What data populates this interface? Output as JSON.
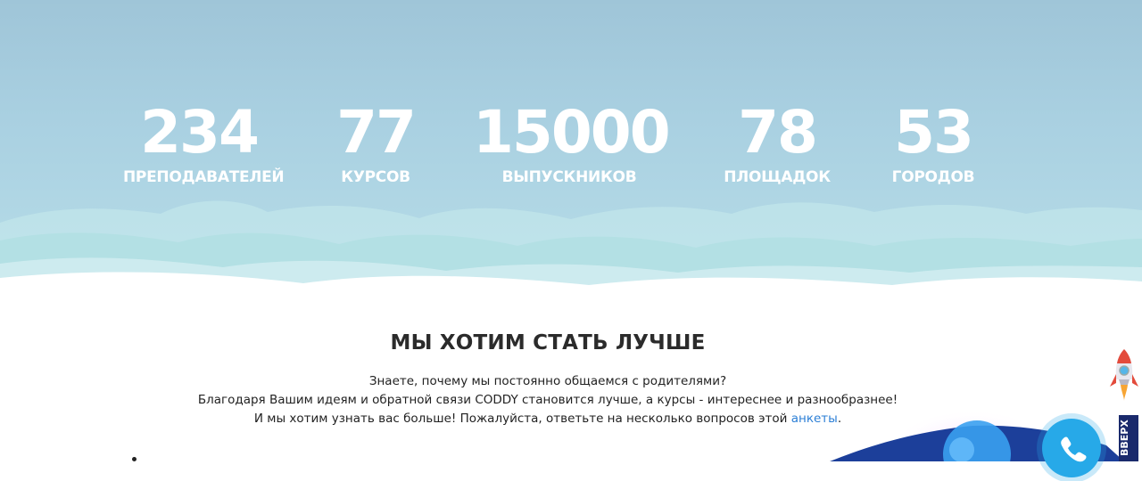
{
  "stats": [
    {
      "value": "234",
      "label": "ПРЕПОДАВАТЕЛЕЙ"
    },
    {
      "value": "77",
      "label": "КУРСОВ"
    },
    {
      "value": "15000",
      "label": "ВЫПУСКНИКОВ"
    },
    {
      "value": "78",
      "label": "ПЛОЩАДОК"
    },
    {
      "value": "53",
      "label": "ГОРОДОВ"
    }
  ],
  "section": {
    "title": "МЫ ХОТИМ СТАТЬ ЛУЧШЕ",
    "line1": "Знаете, почему мы постоянно общаемся с родителями?",
    "line2": "Благодаря Вашим идеям и обратной связи CODDY становится лучше, а курсы - интереснее и разнообразнее!",
    "line3_prefix": "И мы хотим узнать вас больше! Пожалуйста, ответьте на несколько вопросов этой ",
    "line3_link": "анкеты",
    "line3_suffix": "."
  },
  "widgets": {
    "up_label": "ВВЕРХ",
    "phone_icon": "phone-icon",
    "rocket_icon": "rocket-icon"
  },
  "colors": {
    "hero_bg": "#a9d0e1",
    "link": "#2c7fd6",
    "phone_button": "#27a9e8"
  }
}
